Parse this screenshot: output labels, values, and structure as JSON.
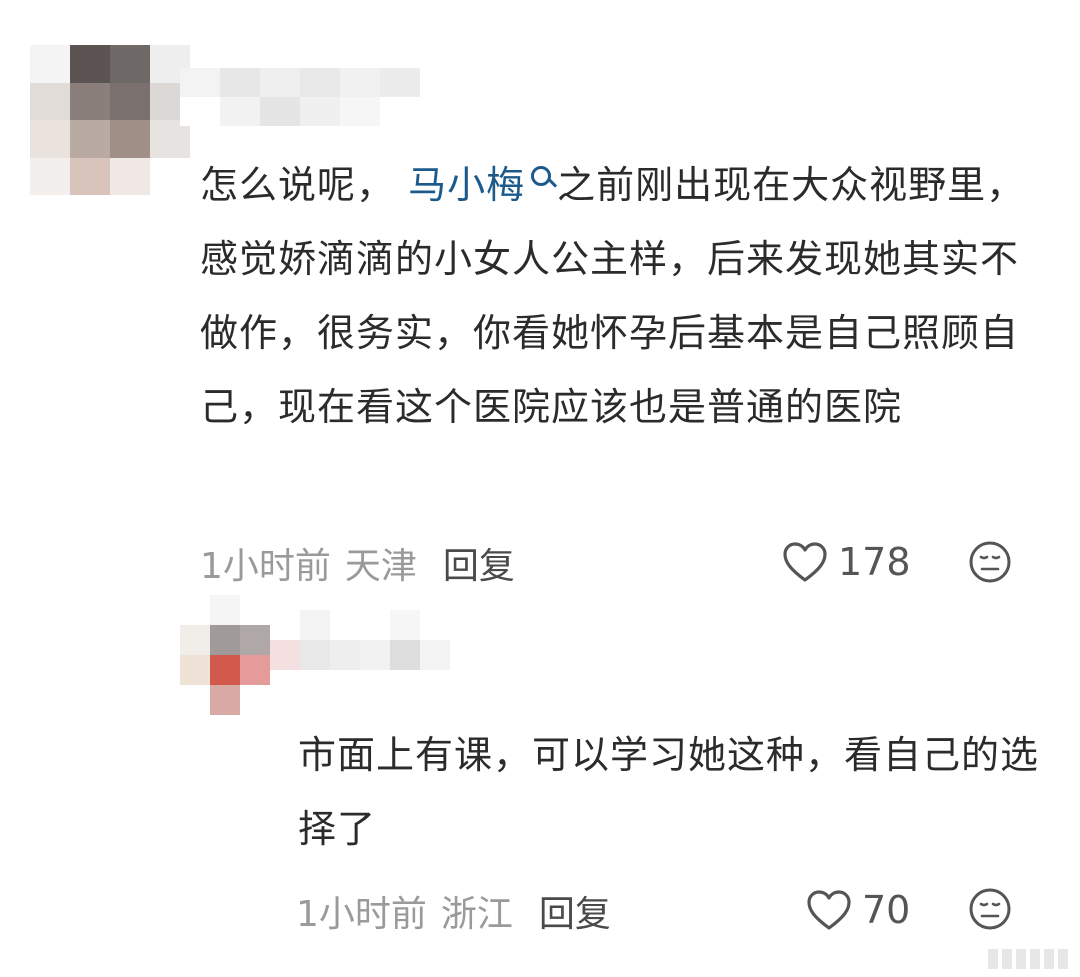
{
  "comment": {
    "text_before_mention": "怎么说呢，",
    "mention": "马小梅",
    "text_after_mention": "之前刚出现在大众视野里，感觉娇滴滴的小女人公主样，后来发现她其实不做作，很务实，你看她怀孕后基本是自己照顾自己，现在看这个医院应该也是普通的医院",
    "time": "1小时前",
    "location": "天津",
    "reply_label": "回复",
    "likes": "178"
  },
  "reply": {
    "text": "市面上有课，可以学习她这种，看自己的选择了",
    "time": "1小时前",
    "location": "浙江",
    "reply_label": "回复",
    "likes": "70"
  },
  "colors": {
    "mention": "#1d5a8c",
    "meta": "#9a9a9a",
    "text": "#2b2b2b"
  },
  "icons": {
    "like": "heart-outline-icon",
    "emoji": "neutral-face-icon",
    "mention": "user-mention-icon"
  }
}
